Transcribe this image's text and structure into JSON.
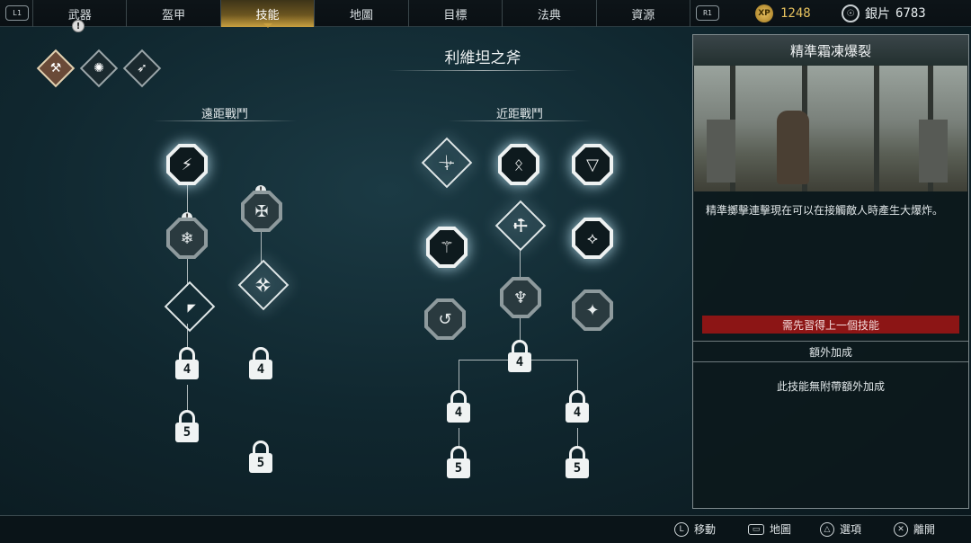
{
  "tabs": [
    "武器",
    "盔甲",
    "技能",
    "地圖",
    "目標",
    "法典",
    "資源"
  ],
  "active_tab": 2,
  "bumpers": {
    "left": "L1",
    "right": "R1"
  },
  "currency": {
    "xp_label": "XP",
    "xp_value": "1248",
    "silver_label": "銀片",
    "silver_value": "6783"
  },
  "weapon": {
    "title": "利維坦之斧"
  },
  "sections": {
    "ranged": "遠距戰鬥",
    "melee": "近距戰鬥"
  },
  "locks": {
    "four": "4",
    "five": "5"
  },
  "panel": {
    "title": "精準霜凍爆裂",
    "description": "精準擲擊連擊現在可以在接觸敵人時產生大爆炸。",
    "requirement": "需先習得上一個技能",
    "extra_header": "額外加成",
    "extra_text": "此技能無附帶額外加成"
  },
  "hints": [
    {
      "button": "L",
      "label": "移動"
    },
    {
      "button": "▭",
      "label": "地圖"
    },
    {
      "button": "△",
      "label": "選項"
    },
    {
      "button": "✕",
      "label": "離開"
    }
  ],
  "icons": {
    "warning": "!",
    "xp": "XP"
  }
}
